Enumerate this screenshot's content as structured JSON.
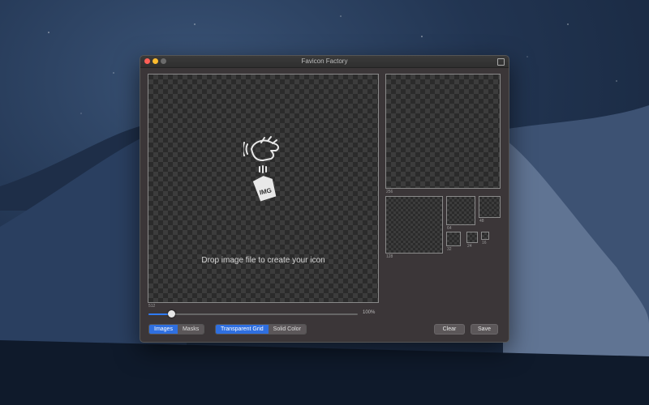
{
  "window": {
    "title": "Favicon Factory"
  },
  "canvas": {
    "drop_text": "Drop image file to create your icon",
    "main_size": "512",
    "icon_badge": "IMG"
  },
  "previews": [
    {
      "size": "256"
    },
    {
      "size": "128"
    },
    {
      "size": "64"
    },
    {
      "size": "48"
    },
    {
      "size": "32"
    },
    {
      "size": "24"
    },
    {
      "size": "16"
    }
  ],
  "zoom": {
    "value": "100%",
    "level": 0.11
  },
  "segments": {
    "mode": [
      "Images",
      "Masks"
    ],
    "background": [
      "Transparent Grid",
      "Solid Color"
    ]
  },
  "buttons": {
    "clear": "Clear",
    "save": "Save"
  },
  "colors": {
    "accent": "#2f6fe0",
    "window_bg": "#3b3638"
  }
}
